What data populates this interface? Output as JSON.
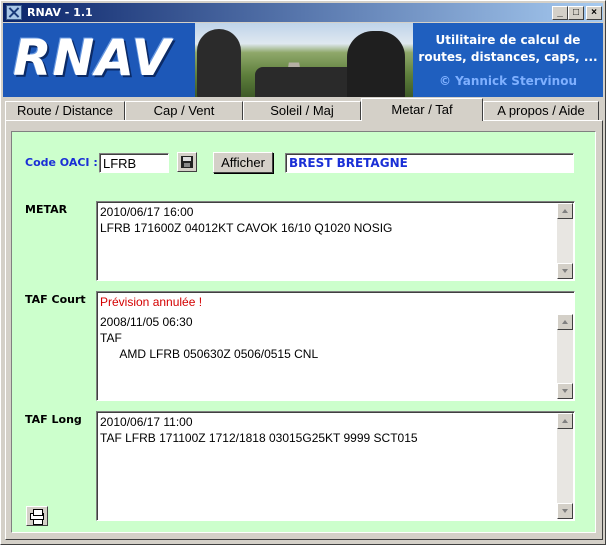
{
  "window": {
    "title": "RNAV - 1.1",
    "controls": {
      "minimize": "_",
      "maximize": "□",
      "close": "×"
    }
  },
  "banner": {
    "logo": "RNAV",
    "line1": "Utilitaire de calcul de",
    "line2": "routes, distances, caps, ...",
    "author": "© Yannick Stervinou"
  },
  "tabs": [
    {
      "label": "Route / Distance",
      "active": false
    },
    {
      "label": "Cap / Vent",
      "active": false
    },
    {
      "label": "Soleil / Maj",
      "active": false
    },
    {
      "label": "Metar / Taf",
      "active": true
    },
    {
      "label": "A propos / Aide",
      "active": false
    }
  ],
  "form": {
    "oaci_label": "Code OACI :",
    "oaci_value": "LFRB",
    "show_button": "Afficher",
    "station_name": "BREST BRETAGNE"
  },
  "metar": {
    "label": "METAR",
    "lines": [
      "2010/06/17 16:00",
      "LFRB 171600Z 04012KT CAVOK 16/10 Q1020 NOSIG"
    ]
  },
  "taf_court": {
    "label": "TAF Court",
    "warning": "Prévision annulée !",
    "lines": [
      "2008/11/05 06:30",
      "TAF",
      "      AMD LFRB 050630Z 0506/0515 CNL"
    ]
  },
  "taf_long": {
    "label": "TAF Long",
    "lines": [
      "2010/06/17 11:00",
      "TAF LFRB 171100Z 1712/1818 03015G25KT 9999 SCT015"
    ]
  },
  "icons": {
    "save": "floppy-disk-icon",
    "print": "printer-icon",
    "app": "plane-icon"
  }
}
